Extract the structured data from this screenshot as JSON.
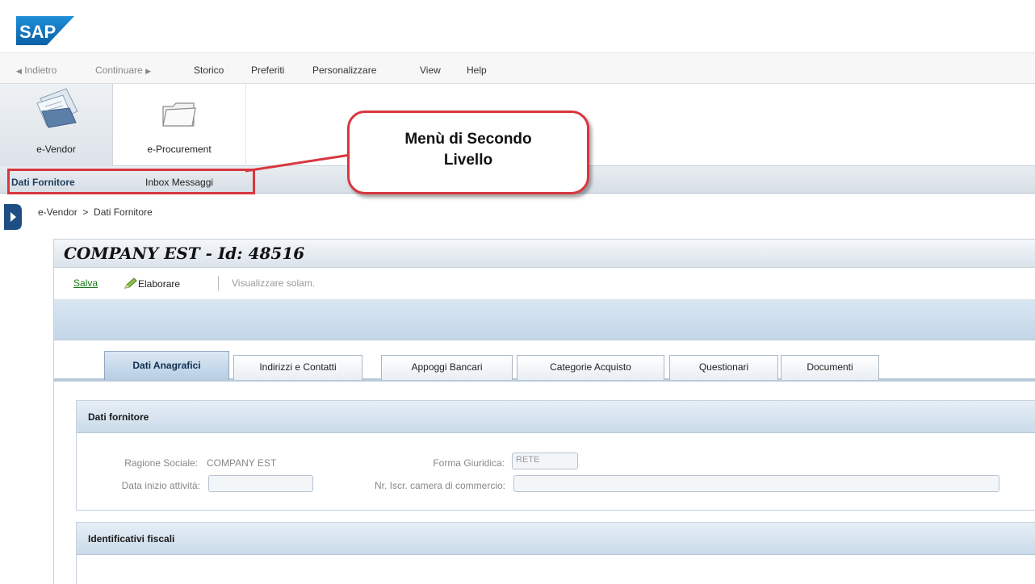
{
  "brand": {
    "logo_text": "SAP"
  },
  "menubar": {
    "back": "Indietro",
    "forward": "Continuare",
    "history": "Storico",
    "favorites": "Preferiti",
    "personalize": "Personalizzare",
    "view": "View",
    "help": "Help"
  },
  "launchpad": {
    "tiles": [
      {
        "label": "e-Vendor",
        "icon": "documents-icon"
      },
      {
        "label": "e-Procurement",
        "icon": "folder-icon"
      }
    ]
  },
  "second_level_menu": {
    "items": [
      {
        "label": "Dati Fornitore",
        "selected": true
      },
      {
        "label": "Inbox Messaggi",
        "selected": false
      }
    ]
  },
  "callout": {
    "line1": "Menù di Secondo",
    "line2": "Livello"
  },
  "breadcrumb": {
    "text": "e-Vendor  >  Dati Fornitore"
  },
  "page": {
    "title": "COMPANY EST - Id: 48516",
    "toolbar": {
      "save": "Salva",
      "edit": "Elaborare",
      "view_only": "Visualizzare solam."
    }
  },
  "tabs": [
    {
      "label": "Dati Anagrafici",
      "active": true
    },
    {
      "label": "Indirizzi e Contatti",
      "active": false
    },
    {
      "label": "Appoggi Bancari",
      "active": false
    },
    {
      "label": "Categorie Acquisto",
      "active": false
    },
    {
      "label": "Questionari",
      "active": false
    },
    {
      "label": "Documenti",
      "active": false
    }
  ],
  "sections": {
    "supplier": {
      "title": "Dati fornitore",
      "company_name_label": "Ragione Sociale:",
      "company_name_value": "COMPANY EST",
      "legal_form_label": "Forma Giuridica:",
      "legal_form_value": "RETE",
      "start_date_label": "Data inizio attività:",
      "start_date_value": "",
      "chamber_label": "Nr. Iscr. camera di commercio:",
      "chamber_value": ""
    },
    "tax": {
      "title": "Identificativi fiscali"
    }
  },
  "colors": {
    "highlight_red": "#d9363e",
    "accent_blue": "#1b3d5e",
    "save_green": "#1b7a1b"
  }
}
